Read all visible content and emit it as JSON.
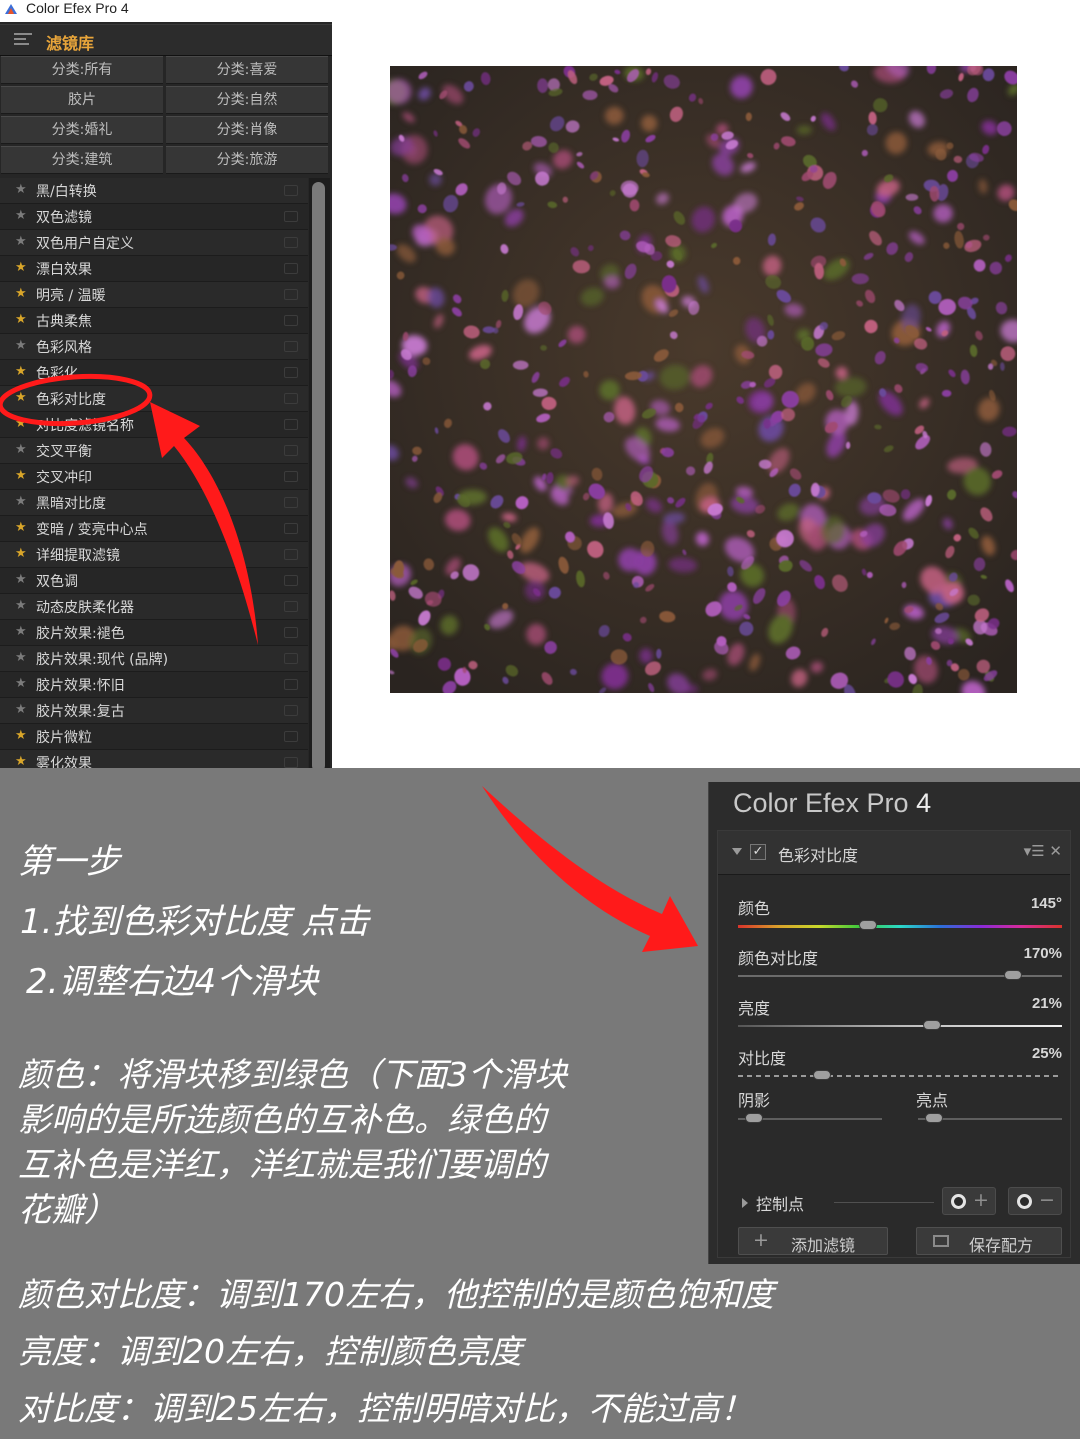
{
  "app": {
    "window_title": "Color Efex Pro 4"
  },
  "library": {
    "title": "滤镜库",
    "categories": [
      "分类:所有",
      "分类:喜爱",
      "胶片",
      "分类:自然",
      "分类:婚礼",
      "分类:肖像",
      "分类:建筑",
      "分类:旅游"
    ],
    "filters": [
      {
        "label": "黑/白转换",
        "fav": false
      },
      {
        "label": "双色滤镜",
        "fav": false
      },
      {
        "label": "双色用户自定义",
        "fav": false
      },
      {
        "label": "漂白效果",
        "fav": true
      },
      {
        "label": "明亮 / 温暖",
        "fav": true
      },
      {
        "label": "古典柔焦",
        "fav": true
      },
      {
        "label": "色彩风格",
        "fav": false
      },
      {
        "label": "色彩化",
        "fav": true
      },
      {
        "label": "色彩对比度",
        "fav": true
      },
      {
        "label": "对比度滤镜名称",
        "fav": true
      },
      {
        "label": "交叉平衡",
        "fav": false
      },
      {
        "label": "交叉冲印",
        "fav": true
      },
      {
        "label": "黑暗对比度",
        "fav": false
      },
      {
        "label": "变暗 / 变亮中心点",
        "fav": true
      },
      {
        "label": "详细提取滤镜",
        "fav": true
      },
      {
        "label": "双色调",
        "fav": false
      },
      {
        "label": "动态皮肤柔化器",
        "fav": false
      },
      {
        "label": "胶片效果:褪色",
        "fav": false
      },
      {
        "label": "胶片效果:现代 (品牌)",
        "fav": false
      },
      {
        "label": "胶片效果:怀旧",
        "fav": false
      },
      {
        "label": "胶片效果:复古",
        "fav": false
      },
      {
        "label": "胶片微粒",
        "fav": true
      },
      {
        "label": "雾化效果",
        "fav": true
      }
    ],
    "highlighted_filter": "色彩对比度"
  },
  "instructions": {
    "step_title": "第一步",
    "step_1": "1.找到色彩对比度 点击",
    "step_2": "2.调整右边4个滑块",
    "color_paragraph": [
      "颜色：将滑块移到绿色（下面3个滑块",
      "影响的是所选颜色的互补色。绿色的",
      "互补色是洋红，洋红就是我们要调的",
      "花瓣）"
    ],
    "saturation_note": "颜色对比度：调到170左右，他控制的是颜色饱和度",
    "brightness_note": "亮度：调到20左右，控制颜色亮度",
    "contrast_note": "对比度：调到25左右，控制明暗对比，不能过高！"
  },
  "cep_panel": {
    "title_main": "Color Efex Pro",
    "title_num": "4",
    "filter_name": "色彩对比度",
    "filter_controls": "▾☰ ✕",
    "sliders": [
      {
        "label": "颜色",
        "value": "145°",
        "level": 0.4,
        "style": "hue"
      },
      {
        "label": "颜色对比度",
        "value": "170%",
        "level": 0.85,
        "style": "plain"
      },
      {
        "label": "亮度",
        "value": "21%",
        "level": 0.6,
        "style": "bright"
      },
      {
        "label": "对比度",
        "value": "25%",
        "level": 0.26,
        "style": "dash"
      }
    ],
    "shadows_label": "阴影",
    "highlights_label": "亮点",
    "shadows_level": 0.05,
    "highlights_level": 0.05,
    "control_points_label": "控制点",
    "add_cp_symbol": "+",
    "remove_cp_symbol": "−",
    "add_filter_label": "添加滤镜",
    "add_filter_symbol": "+",
    "save_recipe_label": "保存配方"
  },
  "colors": {
    "accent_orange": "#e8a53a",
    "star_on": "#d9a62a",
    "annotation_red": "#ff1a1a",
    "instruction_bg": "#797979"
  }
}
